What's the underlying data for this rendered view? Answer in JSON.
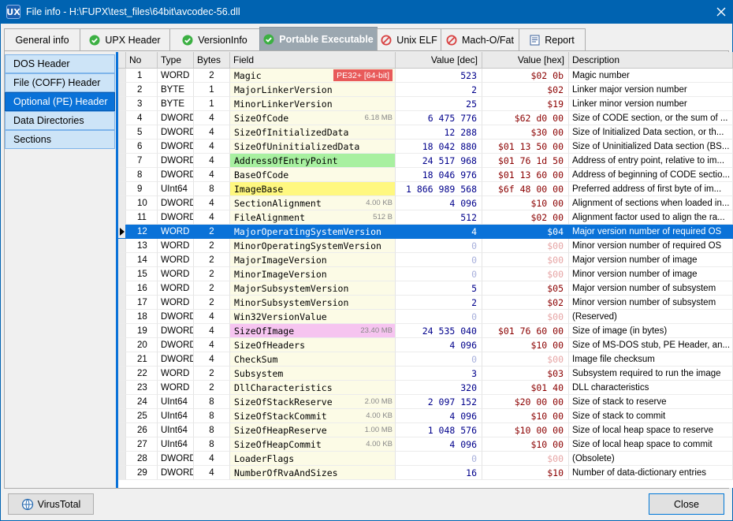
{
  "window": {
    "title": "File info - H:\\FUPX\\test_files\\64bit\\avcodec-56.dll",
    "app_icon": "UX"
  },
  "tabs": [
    {
      "label": "General info",
      "icon": "",
      "active": false
    },
    {
      "label": "UPX Header",
      "icon": "check-circle-icon",
      "active": false
    },
    {
      "label": "VersionInfo",
      "icon": "check-circle-icon",
      "active": false
    },
    {
      "label": "Portable Executable",
      "icon": "check-circle-icon",
      "active": true
    },
    {
      "label": "Unix ELF",
      "icon": "no-entry-icon",
      "active": false
    },
    {
      "label": "Mach-O/Fat",
      "icon": "no-entry-icon",
      "active": false
    },
    {
      "label": "Report",
      "icon": "report-icon",
      "active": false
    }
  ],
  "sidebar": [
    {
      "label": "DOS Header",
      "active": false
    },
    {
      "label": "File (COFF) Header",
      "active": false
    },
    {
      "label": "Optional (PE) Header",
      "active": true
    },
    {
      "label": "Data Directories",
      "active": false
    },
    {
      "label": "Sections",
      "active": false
    }
  ],
  "columns": {
    "no": "No",
    "type": "Type",
    "bytes": "Bytes",
    "field": "Field",
    "dec": "Value [dec]",
    "hex": "Value [hex]",
    "desc": "Description"
  },
  "rows": [
    {
      "no": "1",
      "type": "WORD",
      "bytes": "2",
      "field": "Magic",
      "badge": "PE32+ [64-bit]",
      "size": "",
      "dec": "523",
      "hex": "$02 0b",
      "desc": "Magic number",
      "hl": "",
      "grey": false
    },
    {
      "no": "2",
      "type": "BYTE",
      "bytes": "1",
      "field": "MajorLinkerVersion",
      "badge": "",
      "size": "",
      "dec": "2",
      "hex": "$02",
      "desc": "Linker major version number",
      "hl": "",
      "grey": false
    },
    {
      "no": "3",
      "type": "BYTE",
      "bytes": "1",
      "field": "MinorLinkerVersion",
      "badge": "",
      "size": "",
      "dec": "25",
      "hex": "$19",
      "desc": "Linker minor version number",
      "hl": "",
      "grey": false
    },
    {
      "no": "4",
      "type": "DWORD",
      "bytes": "4",
      "field": "SizeOfCode",
      "badge": "",
      "size": "6.18 MB",
      "dec": "6 475 776",
      "hex": "$62 d0 00",
      "desc": "Size of CODE section, or the sum of ...",
      "hl": "",
      "grey": false
    },
    {
      "no": "5",
      "type": "DWORD",
      "bytes": "4",
      "field": "SizeOfInitializedData",
      "badge": "",
      "size": "",
      "dec": "12 288",
      "hex": "$30 00",
      "desc": "Size of Initialized Data section, or th...",
      "hl": "",
      "grey": false
    },
    {
      "no": "6",
      "type": "DWORD",
      "bytes": "4",
      "field": "SizeOfUninitializedData",
      "badge": "",
      "size": "",
      "dec": "18 042 880",
      "hex": "$01 13 50 00",
      "desc": "Size of Uninitialized Data section (BS...",
      "hl": "",
      "grey": false
    },
    {
      "no": "7",
      "type": "DWORD",
      "bytes": "4",
      "field": "AddressOfEntryPoint",
      "badge": "",
      "size": "",
      "dec": "24 517 968",
      "hex": "$01 76 1d 50",
      "desc": "Address of entry point, relative to im...",
      "hl": "green",
      "grey": false
    },
    {
      "no": "8",
      "type": "DWORD",
      "bytes": "4",
      "field": "BaseOfCode",
      "badge": "",
      "size": "",
      "dec": "18 046 976",
      "hex": "$01 13 60 00",
      "desc": "Address of beginning of CODE sectio...",
      "hl": "",
      "grey": false
    },
    {
      "no": "9",
      "type": "UInt64",
      "bytes": "8",
      "field": "ImageBase",
      "badge": "",
      "size": "",
      "dec": "1 866 989 568",
      "hex": "$6f 48 00 00",
      "desc": "Preferred address of first byte of im...",
      "hl": "yellow",
      "grey": false
    },
    {
      "no": "10",
      "type": "DWORD",
      "bytes": "4",
      "field": "SectionAlignment",
      "badge": "",
      "size": "4.00 KB",
      "dec": "4 096",
      "hex": "$10 00",
      "desc": "Alignment of sections when loaded in...",
      "hl": "",
      "grey": false
    },
    {
      "no": "11",
      "type": "DWORD",
      "bytes": "4",
      "field": "FileAlignment",
      "badge": "",
      "size": "512 B",
      "dec": "512",
      "hex": "$02 00",
      "desc": "Alignment factor used to align the ra...",
      "hl": "",
      "grey": false
    },
    {
      "no": "12",
      "type": "WORD",
      "bytes": "2",
      "field": "MajorOperatingSystemVersion",
      "badge": "",
      "size": "",
      "dec": "4",
      "hex": "$04",
      "desc": "Major version number of required OS",
      "hl": "",
      "grey": false,
      "selected": true
    },
    {
      "no": "13",
      "type": "WORD",
      "bytes": "2",
      "field": "MinorOperatingSystemVersion",
      "badge": "",
      "size": "",
      "dec": "0",
      "hex": "$00",
      "desc": "Minor version number of required OS",
      "hl": "",
      "grey": true
    },
    {
      "no": "14",
      "type": "WORD",
      "bytes": "2",
      "field": "MajorImageVersion",
      "badge": "",
      "size": "",
      "dec": "0",
      "hex": "$00",
      "desc": "Major version number of image",
      "hl": "",
      "grey": true
    },
    {
      "no": "15",
      "type": "WORD",
      "bytes": "2",
      "field": "MinorImageVersion",
      "badge": "",
      "size": "",
      "dec": "0",
      "hex": "$00",
      "desc": "Minor version number of image",
      "hl": "",
      "grey": true
    },
    {
      "no": "16",
      "type": "WORD",
      "bytes": "2",
      "field": "MajorSubsystemVersion",
      "badge": "",
      "size": "",
      "dec": "5",
      "hex": "$05",
      "desc": "Major version number of subsystem",
      "hl": "",
      "grey": false
    },
    {
      "no": "17",
      "type": "WORD",
      "bytes": "2",
      "field": "MinorSubsystemVersion",
      "badge": "",
      "size": "",
      "dec": "2",
      "hex": "$02",
      "desc": "Minor version number of subsystem",
      "hl": "",
      "grey": false
    },
    {
      "no": "18",
      "type": "DWORD",
      "bytes": "4",
      "field": "Win32VersionValue",
      "badge": "",
      "size": "",
      "dec": "0",
      "hex": "$00",
      "desc": "(Reserved)",
      "hl": "",
      "grey": true
    },
    {
      "no": "19",
      "type": "DWORD",
      "bytes": "4",
      "field": "SizeOfImage",
      "badge": "",
      "size": "23.40 MB",
      "dec": "24 535 040",
      "hex": "$01 76 60 00",
      "desc": "Size of image (in bytes)",
      "hl": "pink",
      "grey": false
    },
    {
      "no": "20",
      "type": "DWORD",
      "bytes": "4",
      "field": "SizeOfHeaders",
      "badge": "",
      "size": "",
      "dec": "4 096",
      "hex": "$10 00",
      "desc": "Size of MS-DOS stub, PE Header, an...",
      "hl": "",
      "grey": false
    },
    {
      "no": "21",
      "type": "DWORD",
      "bytes": "4",
      "field": "CheckSum",
      "badge": "",
      "size": "",
      "dec": "0",
      "hex": "$00",
      "desc": "Image file checksum",
      "hl": "",
      "grey": true
    },
    {
      "no": "22",
      "type": "WORD",
      "bytes": "2",
      "field": "Subsystem",
      "badge": "",
      "size": "",
      "dec": "3",
      "hex": "$03",
      "desc": "Subsystem required to run the image",
      "hl": "",
      "grey": false
    },
    {
      "no": "23",
      "type": "WORD",
      "bytes": "2",
      "field": "DllCharacteristics",
      "badge": "",
      "size": "",
      "dec": "320",
      "hex": "$01 40",
      "desc": "DLL characteristics",
      "hl": "",
      "grey": false
    },
    {
      "no": "24",
      "type": "UInt64",
      "bytes": "8",
      "field": "SizeOfStackReserve",
      "badge": "",
      "size": "2.00 MB",
      "dec": "2 097 152",
      "hex": "$20 00 00",
      "desc": "Size of stack to reserve",
      "hl": "",
      "grey": false
    },
    {
      "no": "25",
      "type": "UInt64",
      "bytes": "8",
      "field": "SizeOfStackCommit",
      "badge": "",
      "size": "4.00 KB",
      "dec": "4 096",
      "hex": "$10 00",
      "desc": "Size of stack to commit",
      "hl": "",
      "grey": false
    },
    {
      "no": "26",
      "type": "UInt64",
      "bytes": "8",
      "field": "SizeOfHeapReserve",
      "badge": "",
      "size": "1.00 MB",
      "dec": "1 048 576",
      "hex": "$10 00 00",
      "desc": "Size of local heap space to reserve",
      "hl": "",
      "grey": false
    },
    {
      "no": "27",
      "type": "UInt64",
      "bytes": "8",
      "field": "SizeOfHeapCommit",
      "badge": "",
      "size": "4.00 KB",
      "dec": "4 096",
      "hex": "$10 00",
      "desc": "Size of local heap space to commit",
      "hl": "",
      "grey": false
    },
    {
      "no": "28",
      "type": "DWORD",
      "bytes": "4",
      "field": "LoaderFlags",
      "badge": "",
      "size": "",
      "dec": "0",
      "hex": "$00",
      "desc": "(Obsolete)",
      "hl": "",
      "grey": true
    },
    {
      "no": "29",
      "type": "DWORD",
      "bytes": "4",
      "field": "NumberOfRvaAndSizes",
      "badge": "",
      "size": "",
      "dec": "16",
      "hex": "$10",
      "desc": "Number of data-dictionary entries",
      "hl": "",
      "grey": false
    }
  ],
  "buttons": {
    "virustotal": "VirusTotal",
    "close": "Close"
  }
}
